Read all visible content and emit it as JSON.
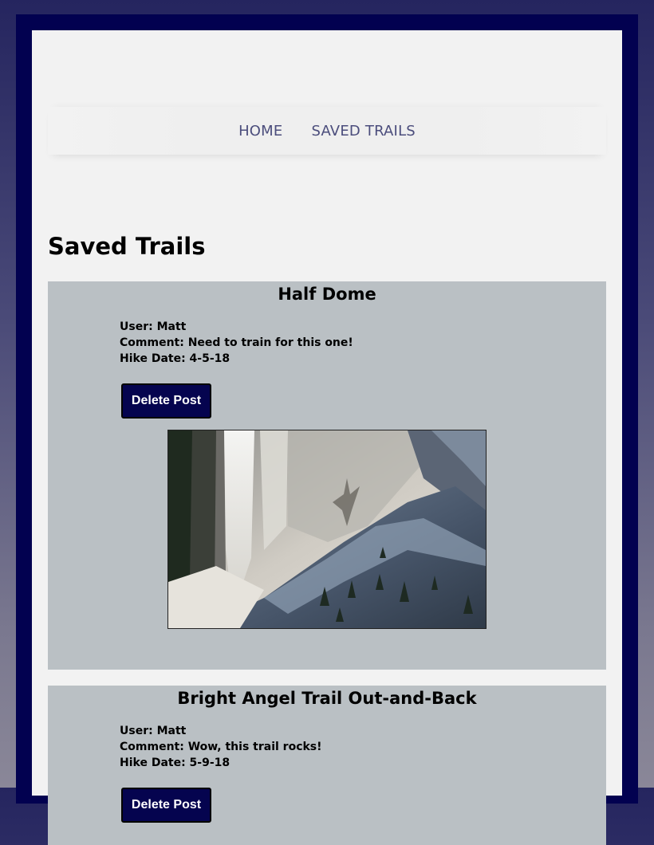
{
  "nav": {
    "items": [
      {
        "label": "HOME"
      },
      {
        "label": "SAVED TRAILS"
      }
    ],
    "link_color": "#4b4d7c"
  },
  "page_title": "Saved Trails",
  "delete_button_label": "Delete Post",
  "posts": [
    {
      "title": "Half Dome",
      "user": "User: Matt",
      "comment": "Comment: Need to train for this one!",
      "hike_date": "Hike Date: 4-5-18",
      "photo": "waterfall-granite-cliff"
    },
    {
      "title": "Bright Angel Trail Out-and-Back",
      "user": "User: Matt",
      "comment": "Comment: Wow, this trail rocks!",
      "hike_date": "Hike Date: 5-9-18"
    }
  ],
  "colors": {
    "frame": "#020150",
    "page": "#f2f2f2",
    "card": "#bac0c4",
    "button": "#05044f"
  }
}
